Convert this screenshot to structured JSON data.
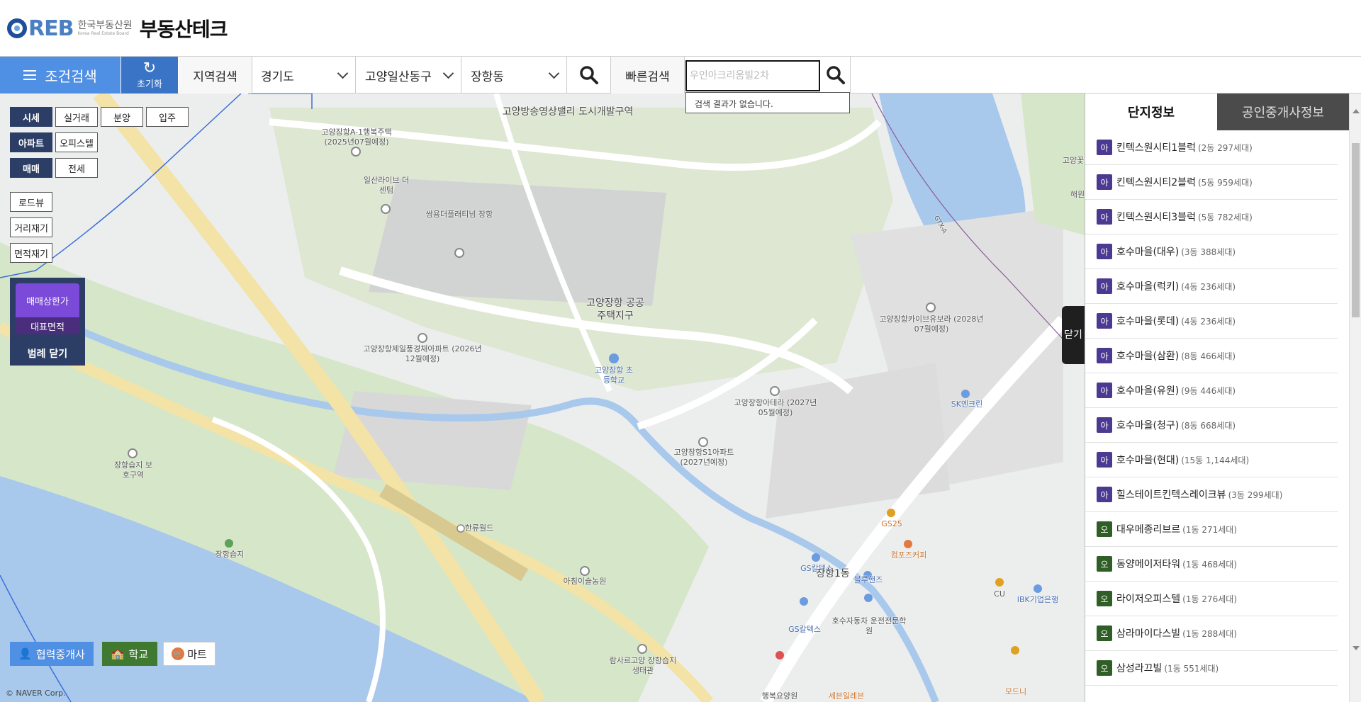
{
  "header": {
    "logo_mark": "REB",
    "logo_org_kr": "한국부동산원",
    "logo_org_en": "Korea Real Estate Board",
    "app_title": "부동산테크"
  },
  "toolbar": {
    "condition_search": "조건검색",
    "reset": "초기화",
    "region_search": "지역검색",
    "province": "경기도",
    "district": "고양일산동구",
    "dong": "장항동",
    "quick_search": "빠른검색",
    "quick_search_placeholder": "우인아크리움빌2차",
    "no_result": "검색 결과가 없습니다."
  },
  "filters": {
    "price": "시세",
    "actual_trade": "실거래",
    "presale": "분양",
    "move_in": "입주",
    "apartment": "아파트",
    "officetel": "오피스텔",
    "sale": "매매",
    "jeonse": "전세",
    "roadview": "로드뷰",
    "distance": "거리재기",
    "area": "면적재기"
  },
  "legend": {
    "price_label": "매매상한가",
    "area_label": "대표면적",
    "close": "범례 닫기"
  },
  "bottom_buttons": {
    "broker": "협력중개사",
    "school": "학교",
    "mart": "마트"
  },
  "map": {
    "copyright": "© NAVER Corp.",
    "labels": [
      "고양방송영상밸리 도시개발구역",
      "고양장항A-1행복주택 (2025년07월예정)",
      "일산라이브 더센텀",
      "쌍용더플래티넘 장항",
      "고양장항 공공주택지구",
      "고양장항제일풍경채아파트 (2026년12월예정)",
      "고양장항 초등학교",
      "고양장항카이브유보라 (2028년07월예정)",
      "고양장항아테라 (2027년05월예정)",
      "고양장항S1아파트 (2027년예정)",
      "SK엔크린",
      "장항습지 보호구역",
      "장항습지",
      "한류월드",
      "아침이슬농원",
      "람사르고양 장항습지생태관",
      "GS25",
      "컴포즈커피",
      "GS칼텍스",
      "장항1동",
      "블루핸즈",
      "호수자동차 운전전문학원",
      "CU",
      "IBK기업은행",
      "GS칼텍스",
      "행복요양원",
      "세븐일레븐",
      "모드니",
      "GTX-A",
      "고양꽃",
      "해원"
    ]
  },
  "panel": {
    "tab_complex": "단지정보",
    "tab_broker": "공인중개사정보",
    "toggle": "닫기",
    "complexes": [
      {
        "type": "아",
        "name": "킨텍스원시티1블럭",
        "info": "(2동 297세대)"
      },
      {
        "type": "아",
        "name": "킨텍스원시티2블럭",
        "info": "(5동 959세대)"
      },
      {
        "type": "아",
        "name": "킨텍스원시티3블럭",
        "info": "(5동 782세대)"
      },
      {
        "type": "아",
        "name": "호수마을(대우)",
        "info": "(3동 388세대)"
      },
      {
        "type": "아",
        "name": "호수마을(럭키)",
        "info": "(4동 236세대)"
      },
      {
        "type": "아",
        "name": "호수마을(롯데)",
        "info": "(4동 236세대)"
      },
      {
        "type": "아",
        "name": "호수마을(삼환)",
        "info": "(8동 466세대)"
      },
      {
        "type": "아",
        "name": "호수마을(유원)",
        "info": "(9동 446세대)"
      },
      {
        "type": "아",
        "name": "호수마을(청구)",
        "info": "(8동 668세대)"
      },
      {
        "type": "아",
        "name": "호수마을(현대)",
        "info": "(15동 1,144세대)"
      },
      {
        "type": "아",
        "name": "힐스테이트킨텍스레이크뷰",
        "info": "(3동 299세대)"
      },
      {
        "type": "오",
        "name": "대우메종리브르",
        "info": "(1동 271세대)"
      },
      {
        "type": "오",
        "name": "동양메이저타워",
        "info": "(1동 468세대)"
      },
      {
        "type": "오",
        "name": "라이저오피스텔",
        "info": "(1동 276세대)"
      },
      {
        "type": "오",
        "name": "삼라마이다스빌",
        "info": "(1동 288세대)"
      },
      {
        "type": "오",
        "name": "삼성라끄빌",
        "info": "(1동 551세대)"
      }
    ]
  }
}
